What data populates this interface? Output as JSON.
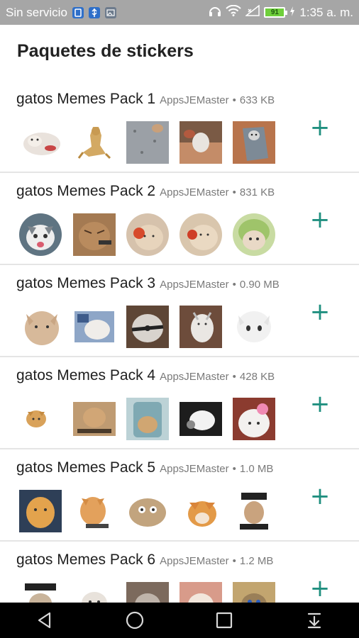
{
  "status_bar": {
    "carrier": "Sin servicio",
    "time": "1:35 a. m.",
    "battery": "91",
    "icons": [
      "sim-icon",
      "usb-icon",
      "image-icon",
      "headphones-icon",
      "wifi-icon",
      "signal-icon",
      "battery-icon",
      "charging-icon"
    ]
  },
  "header": {
    "title": "Paquetes de stickers"
  },
  "packs": [
    {
      "name": "gatos Memes Pack 1",
      "publisher": "AppsJEMaster",
      "dot": "•",
      "size": "633 KB"
    },
    {
      "name": "gatos Memes Pack 2",
      "publisher": "AppsJEMaster",
      "dot": "•",
      "size": "831 KB"
    },
    {
      "name": "gatos Memes Pack 3",
      "publisher": "AppsJEMaster",
      "dot": "•",
      "size": "0.90 MB"
    },
    {
      "name": "gatos Memes Pack 4",
      "publisher": "AppsJEMaster",
      "dot": "•",
      "size": "428 KB"
    },
    {
      "name": "gatos Memes Pack 5",
      "publisher": "AppsJEMaster",
      "dot": "•",
      "size": "1.0 MB"
    },
    {
      "name": "gatos Memes Pack 6",
      "publisher": "AppsJEMaster",
      "dot": "•",
      "size": "1.2 MB"
    }
  ],
  "add_label": "+",
  "nav": {
    "icons": [
      "back-icon",
      "home-icon",
      "recents-icon",
      "notification-drawer-icon"
    ]
  },
  "colors": {
    "status_bar": "#a6a6a6",
    "accent": "#1f8f7f",
    "nav_bar": "#000000"
  }
}
